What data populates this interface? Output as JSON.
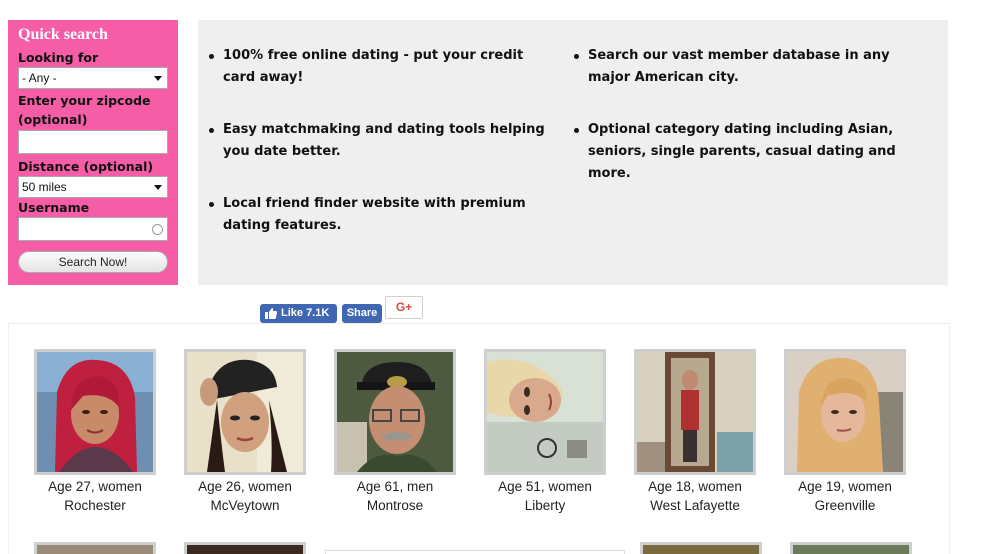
{
  "quick_search": {
    "title": "Quick search",
    "looking_for_label": "Looking for",
    "looking_for_value": "- Any -",
    "zipcode_label": "Enter your zipcode (optional)",
    "zipcode_value": "",
    "distance_label": "Distance (optional)",
    "distance_value": "50 miles",
    "username_label": "Username",
    "username_value": "",
    "search_button": "Search Now!"
  },
  "features": {
    "left": [
      "100% free online dating - put your credit card away!",
      "Easy matchmaking and dating tools helping you date better.",
      "Local friend finder website with premium dating features."
    ],
    "right": [
      "Search our vast member database in any major American city.",
      "Optional category dating including Asian, seniors, single parents, casual dating and more."
    ]
  },
  "social": {
    "like_label": "Like 7.1K",
    "share_label": "Share",
    "gplus_label": "G+"
  },
  "members": [
    {
      "age": "Age 27, women",
      "city": "Rochester",
      "photo": "woman-red-hair"
    },
    {
      "age": "Age 26, women",
      "city": "McVeytown",
      "photo": "woman-black-cap"
    },
    {
      "age": "Age 61, men",
      "city": "Montrose",
      "photo": "man-cap-glasses"
    },
    {
      "age": "Age 51, women",
      "city": "Liberty",
      "photo": "woman-blonde-sideways"
    },
    {
      "age": "Age 18, women",
      "city": "West Lafayette",
      "photo": "woman-mirror-selfie"
    },
    {
      "age": "Age 19, women",
      "city": "Greenville",
      "photo": "woman-blonde-hair"
    }
  ],
  "colors": {
    "panel_pink": "#f55ea7",
    "features_gray": "#efefef",
    "facebook_blue": "#4267b2",
    "gplus_red": "#dd4b39"
  }
}
